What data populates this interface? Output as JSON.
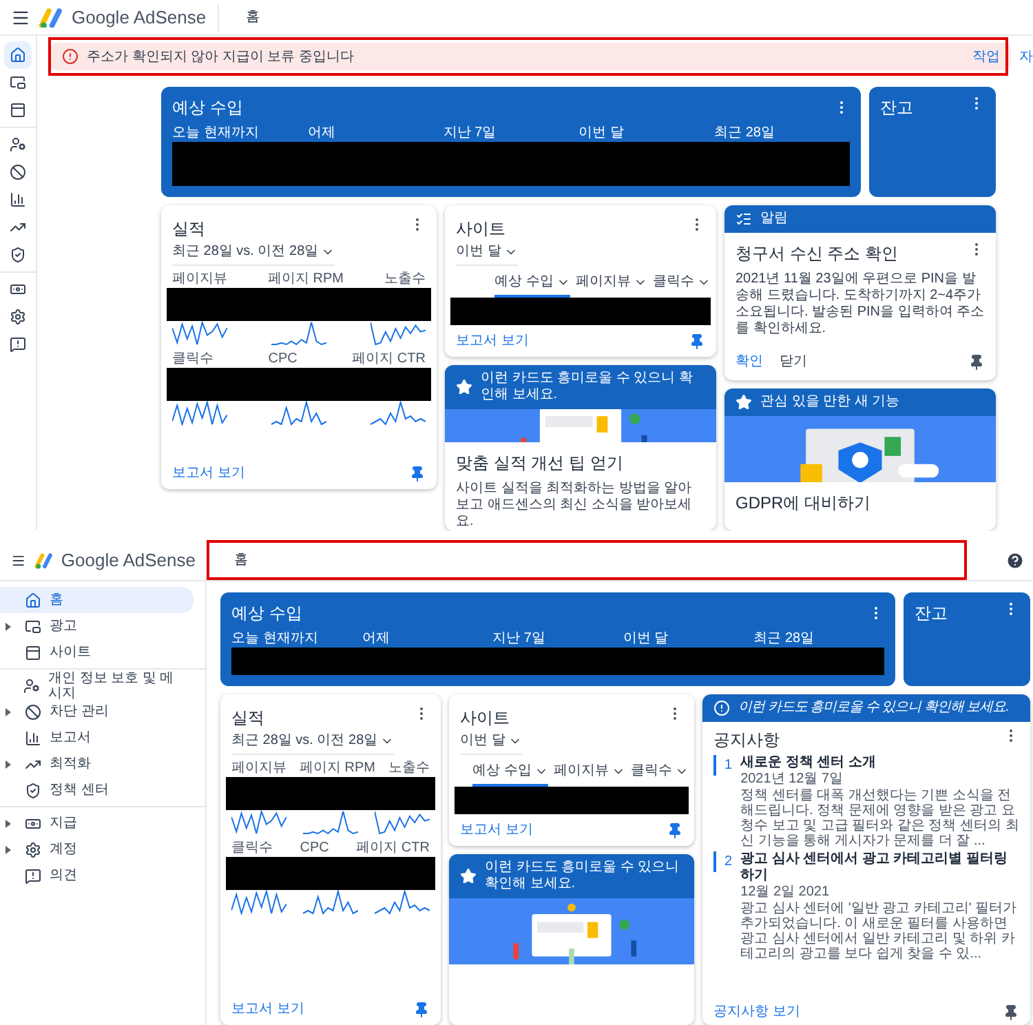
{
  "panels": [
    {
      "header": {
        "app_name": "Google AdSense",
        "page_title": "홈",
        "help_button": false
      },
      "banner": {
        "message": "주소가 확인되지 않아 지급이 보류 중입니다",
        "actions": [
          "작업",
          "자"
        ]
      },
      "sidebar": {
        "items": [
          {
            "selected": true
          },
          {
            "selected": false
          },
          {
            "selected": false
          },
          {
            "selected": false
          },
          {
            "selected": false
          },
          {
            "selected": false
          },
          {
            "selected": false
          },
          {
            "selected": false
          },
          {
            "selected": false
          },
          {
            "selected": false
          },
          {
            "selected": false
          }
        ]
      },
      "earnings": {
        "title": "예상 수입",
        "periods": [
          "오늘 현재까지",
          "어제",
          "지난 7일",
          "이번 달",
          "최근 28일"
        ]
      },
      "balance": {
        "title": "잔고"
      },
      "performance": {
        "title": "실적",
        "range": "최근 28일 vs. 이전 28일",
        "metrics": [
          "페이지뷰",
          "페이지 RPM",
          "노출수",
          "클릭수",
          "CPC",
          "페이지 CTR"
        ],
        "link": "보고서 보기",
        "pinned": true
      },
      "sites": {
        "title": "사이트",
        "range": "이번 달",
        "columns": [
          {
            "label": "예상 수입",
            "selected": true
          },
          {
            "label": "페이지뷰",
            "selected": false
          },
          {
            "label": "클릭수",
            "selected": false
          }
        ],
        "link": "보고서 보기",
        "pinned": true
      },
      "middle_cards": [
        {
          "kind": "promo",
          "header": "이런 카드도 흥미로울 수 있으니 확인해 보세요.",
          "title": "맞춤 실적 개선 팁 얻기",
          "body": "사이트 실적을 최적화하는 방법을 알아보고 애드센스의 최신 소식을 받아보세요."
        }
      ],
      "right_cards": [
        {
          "kind": "alert",
          "header": "알림",
          "title": "청구서 수신 주소 확인",
          "body": "2021년 11월 23일에 우편으로 PIN을 발송해 드렸습니다. 도착하기까지 2~4주가 소요됩니다. 발송된 PIN을 입력하여 주소를 확인하세요.",
          "actions": [
            "확인",
            "닫기"
          ],
          "pinned": false
        },
        {
          "kind": "feature",
          "header": "관심 있을 만한 새 기능",
          "title": "GDPR에 대비하기"
        }
      ]
    },
    {
      "header": {
        "app_name": "Google AdSense",
        "page_title": "홈",
        "help_button": true
      },
      "sidebar": {
        "items": [
          {
            "label": "홈",
            "selected": true,
            "expandable": false
          },
          {
            "label": "광고",
            "selected": false,
            "expandable": true
          },
          {
            "label": "사이트",
            "selected": false,
            "expandable": false
          },
          {
            "label": "개인 정보 보호 및 메시지",
            "selected": false,
            "expandable": false
          },
          {
            "label": "차단 관리",
            "selected": false,
            "expandable": true
          },
          {
            "label": "보고서",
            "selected": false,
            "expandable": false
          },
          {
            "label": "최적화",
            "selected": false,
            "expandable": true
          },
          {
            "label": "정책 센터",
            "selected": false,
            "expandable": false
          },
          {
            "label": "지급",
            "selected": false,
            "expandable": true
          },
          {
            "label": "계정",
            "selected": false,
            "expandable": true
          },
          {
            "label": "의견",
            "selected": false,
            "expandable": false
          }
        ]
      },
      "earnings": {
        "title": "예상 수입",
        "periods": [
          "오늘 현재까지",
          "어제",
          "지난 7일",
          "이번 달",
          "최근 28일"
        ]
      },
      "balance": {
        "title": "잔고"
      },
      "performance": {
        "title": "실적",
        "range": "최근 28일 vs. 이전 28일",
        "metrics": [
          "페이지뷰",
          "페이지 RPM",
          "노출수",
          "클릭수",
          "CPC",
          "페이지 CTR"
        ],
        "link": "보고서 보기",
        "pinned": true
      },
      "sites": {
        "title": "사이트",
        "range": "이번 달",
        "columns": [
          {
            "label": "예상 수입",
            "selected": true
          },
          {
            "label": "페이지뷰",
            "selected": false
          },
          {
            "label": "클릭수",
            "selected": false
          }
        ],
        "link": "보고서 보기",
        "pinned": true
      },
      "middle_cards": [
        {
          "kind": "promo",
          "header": "이런 카드도 흥미로울 수 있으니 확인해 보세요."
        }
      ],
      "right_cards": [
        {
          "kind": "notices",
          "header": "이런 카드도 흥미로울 수 있으니 확인해 보세요.",
          "title": "공지사항",
          "items": [
            {
              "number": "1",
              "title": "새로운 정책 센터 소개",
              "date": "2021년 12월 7일",
              "body": "정책 센터를 대폭 개선했다는 기쁜 소식을 전해드립니다. 정책 문제에 영향을 받은 광고 요청수 보고 및 고급 필터와 같은 정책 센터의 최신 기능을 통해 게시자가 문제를 더 잘 ..."
            },
            {
              "number": "2",
              "title": "광고 심사 센터에서 광고 카테고리별 필터링하기",
              "date": "12월 2일 2021",
              "body": "광고 심사 센터에 '일반 광고 카테고리' 필터가 추가되었습니다. 이 새로운 필터를 사용하면 광고 심사 센터에서 일반 카테고리 및 하위 카테고리의 광고를 보다 쉽게 찾을 수 있..."
            }
          ],
          "link": "공지사항 보기",
          "pinned": false
        }
      ]
    }
  ]
}
